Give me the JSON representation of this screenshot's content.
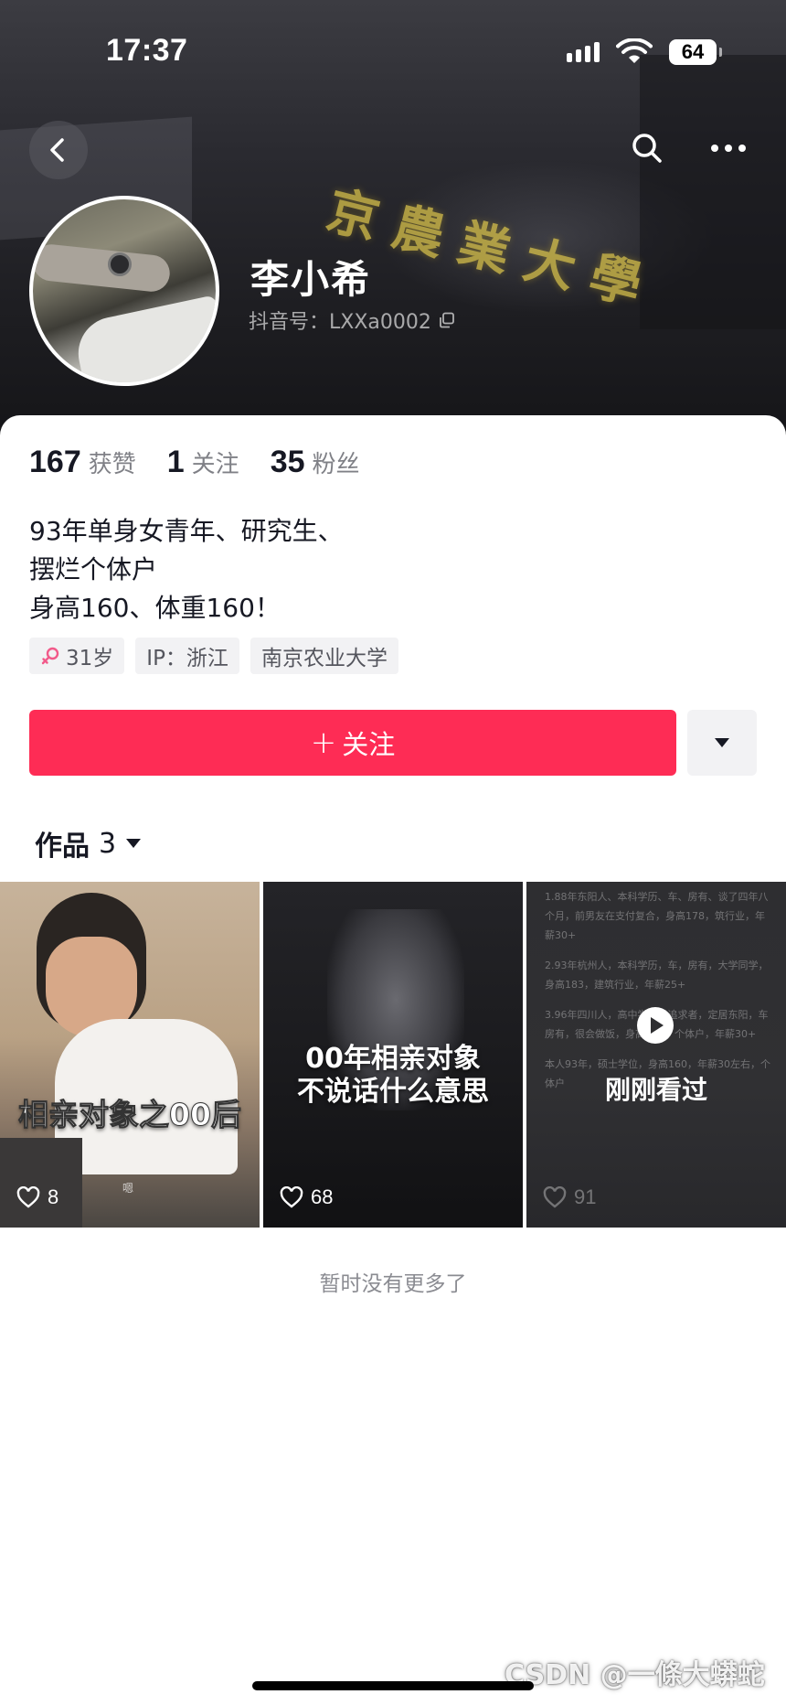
{
  "status_bar": {
    "time": "17:37",
    "battery": "64"
  },
  "profile": {
    "name": "李小希",
    "douyin_id": "抖音号：LXXa0002",
    "banner_text": "京農業大學"
  },
  "stats": [
    {
      "value": "167",
      "label": "获赞"
    },
    {
      "value": "1",
      "label": "关注"
    },
    {
      "value": "35",
      "label": "粉丝"
    }
  ],
  "bio": [
    "93年单身女青年、研究生、",
    "摆烂个体户",
    "身高160、体重160！"
  ],
  "tags": {
    "age": "31岁",
    "ip": "IP：浙江",
    "school": "南京农业大学"
  },
  "actions": {
    "follow": "关注",
    "follow_plus": "+"
  },
  "works": {
    "label": "作品",
    "count": "3"
  },
  "videos": [
    {
      "title": "相亲对象之00后",
      "likes": "8",
      "caption_small": "嗯"
    },
    {
      "title_line1": "00年相亲对象",
      "title_line2": "不说话什么意思",
      "likes": "68"
    },
    {
      "recent_label": "刚刚看过",
      "likes": "91",
      "text_lines": [
        "1.88年东阳人、本科学历、车、房有、谈了四年八个月，前男友在支付复合，身高178，筑行业，年薪30+",
        "2.93年杭州人，本科学历，车，房有，大学同学，身高183，建筑行业，年薪25+",
        "3.96年四川人，高中学历，追求者，定居东阳，车房有，很会做饭，身高185，个体户，年薪30+",
        "本人93年，硕士学位，身高160，年薪30左右，个体户"
      ]
    }
  ],
  "footer": {
    "no_more": "暂时没有更多了"
  },
  "watermark": "CSDN @一條大蟒蛇",
  "colors": {
    "accent": "#fe2c55",
    "text": "#161823"
  }
}
